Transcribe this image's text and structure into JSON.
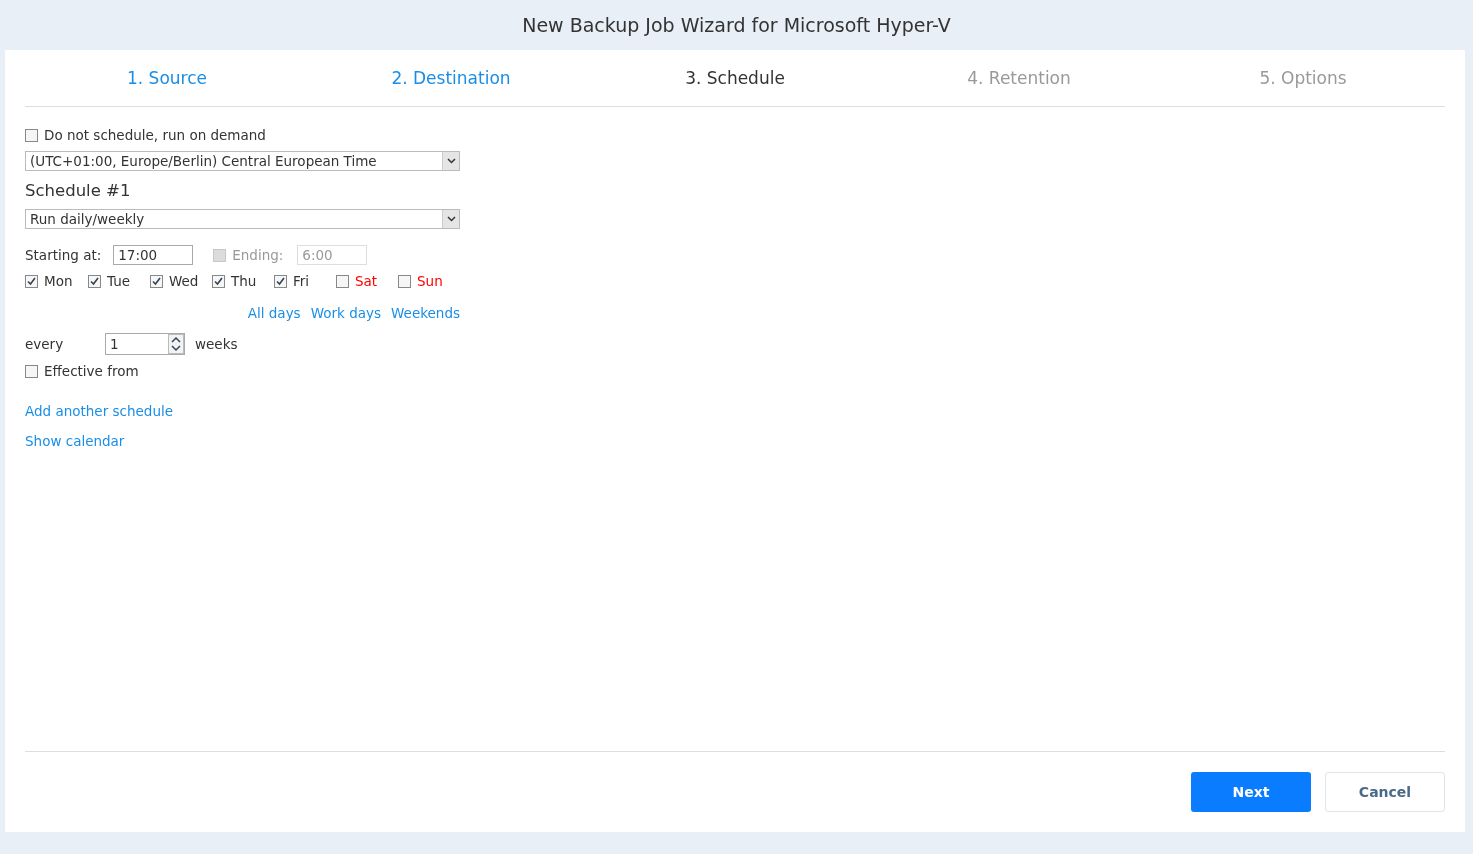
{
  "window": {
    "title": "New Backup Job Wizard for Microsoft Hyper-V"
  },
  "steps": [
    {
      "label": "1. Source",
      "completed": true,
      "selected": false
    },
    {
      "label": "2. Destination",
      "completed": true,
      "selected": false
    },
    {
      "label": "3. Schedule",
      "completed": false,
      "selected": true
    },
    {
      "label": "4. Retention",
      "completed": false,
      "selected": false
    },
    {
      "label": "5. Options",
      "completed": false,
      "selected": false
    }
  ],
  "on_demand": {
    "label": "Do not schedule, run on demand",
    "checked": false
  },
  "timezone": {
    "value": "(UTC+01:00, Europe/Berlin) Central European Time"
  },
  "schedule": {
    "title": "Schedule #1",
    "mode": "Run daily/weekly",
    "starting": {
      "label": "Starting at:",
      "value": "17:00"
    },
    "ending": {
      "label": "Ending:",
      "value": "6:00",
      "checked": false,
      "disabled": true
    },
    "days": [
      {
        "label": "Mon",
        "checked": true,
        "color": "#333333"
      },
      {
        "label": "Tue",
        "checked": true,
        "color": "#333333"
      },
      {
        "label": "Wed",
        "checked": true,
        "color": "#333333"
      },
      {
        "label": "Thu",
        "checked": true,
        "color": "#333333"
      },
      {
        "label": "Fri",
        "checked": true,
        "color": "#333333"
      },
      {
        "label": "Sat",
        "checked": false,
        "color": "#ff0000"
      },
      {
        "label": "Sun",
        "checked": false,
        "color": "#ff0000"
      }
    ],
    "day_links": [
      "All days",
      "Work days",
      "Weekends"
    ],
    "every": {
      "label": "every",
      "value": "1",
      "unit": "weeks"
    },
    "effective_from": {
      "label": "Effective from",
      "checked": false
    }
  },
  "links": [
    "Add another schedule",
    "Show calendar"
  ],
  "buttons": {
    "next": "Next",
    "cancel": "Cancel"
  }
}
